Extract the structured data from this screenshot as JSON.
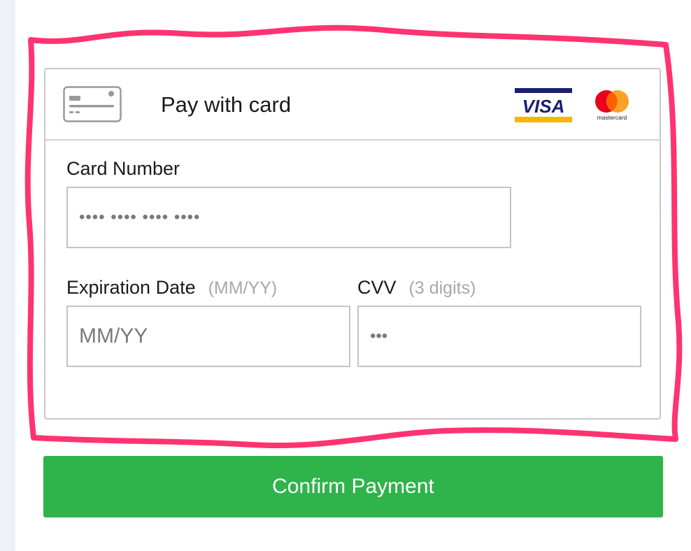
{
  "header": {
    "title": "Pay with card",
    "card_icon": "credit-card-icon",
    "brands": [
      {
        "name": "VISA",
        "icon": "visa-logo",
        "color": "#1a1f71",
        "accent": "#f7b600"
      },
      {
        "name": "mastercard",
        "icon": "mastercard-logo",
        "red": "#eb001b",
        "orange": "#f79e1b"
      }
    ]
  },
  "form": {
    "card_number": {
      "label": "Card Number",
      "placeholder": "•••• •••• •••• ••••"
    },
    "expiration": {
      "label": "Expiration Date",
      "hint": "(MM/YY)",
      "placeholder": "MM/YY"
    },
    "cvv": {
      "label": "CVV",
      "hint": "(3 digits)",
      "placeholder": "•••"
    }
  },
  "confirm_button": {
    "label": "Confirm Payment",
    "color": "#2fb34b"
  },
  "annotation": {
    "color": "#ff3370"
  }
}
